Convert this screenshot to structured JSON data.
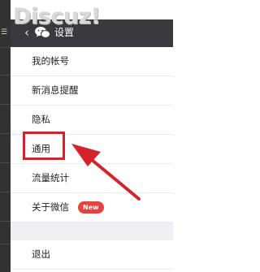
{
  "watermark": "Discuz!",
  "header": {
    "title": "设置"
  },
  "icons": {
    "back": "chevron-left-icon",
    "chat": "wechat-bubbles-icon"
  },
  "menu": {
    "items": [
      {
        "label": "我的帐号"
      },
      {
        "label": "新消息提醒"
      },
      {
        "label": "隐私"
      },
      {
        "label": "通用"
      },
      {
        "label": "流量统计"
      },
      {
        "label": "关于微信",
        "badge": "New"
      }
    ],
    "logout": {
      "label": "退出"
    }
  },
  "colors": {
    "titlebar": "#393a3f",
    "highlight": "#d6232a",
    "badge": "#e64340",
    "group_gap": "#efeff4"
  }
}
